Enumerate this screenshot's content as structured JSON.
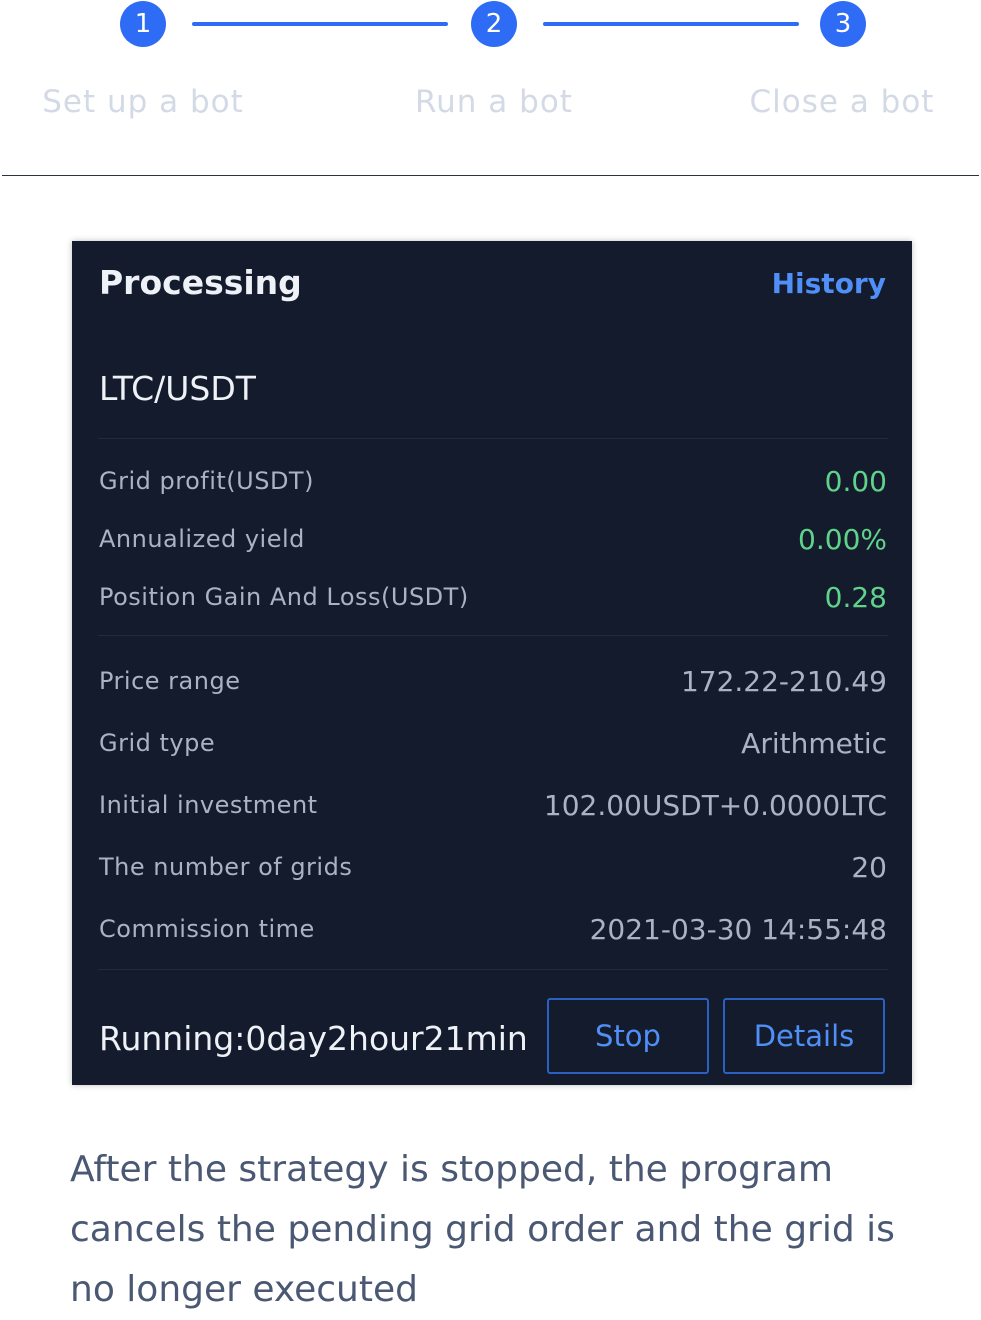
{
  "stepper": {
    "steps": [
      {
        "number": "1",
        "label": "Set up a bot"
      },
      {
        "number": "2",
        "label": "Run a bot"
      },
      {
        "number": "3",
        "label": "Close a bot"
      }
    ],
    "accent_color": "#2f6cf5"
  },
  "card": {
    "title": "Processing",
    "history_link": "History",
    "pair": "LTC/USDT",
    "profit_rows": [
      {
        "label": "Grid profit(USDT)",
        "value": "0.00"
      },
      {
        "label": "Annualized yield",
        "value": "0.00%"
      },
      {
        "label": "Position Gain And Loss(USDT)",
        "value": "0.28"
      }
    ],
    "info_rows": [
      {
        "label": "Price range",
        "value": "172.22-210.49"
      },
      {
        "label": "Grid type",
        "value": "Arithmetic"
      },
      {
        "label": "Initial investment",
        "value": "102.00USDT+0.0000LTC"
      },
      {
        "label": "The number of grids",
        "value": "20"
      },
      {
        "label": "Commission time",
        "value": "2021-03-30 14:55:48"
      }
    ],
    "running": "Running:0day2hour21min",
    "stop_button": "Stop",
    "details_button": "Details",
    "background_color": "#141b2c",
    "positive_color": "#5fd38a"
  },
  "caption": "After the strategy is stopped, the program cancels the pending grid order and the grid is no longer executed"
}
